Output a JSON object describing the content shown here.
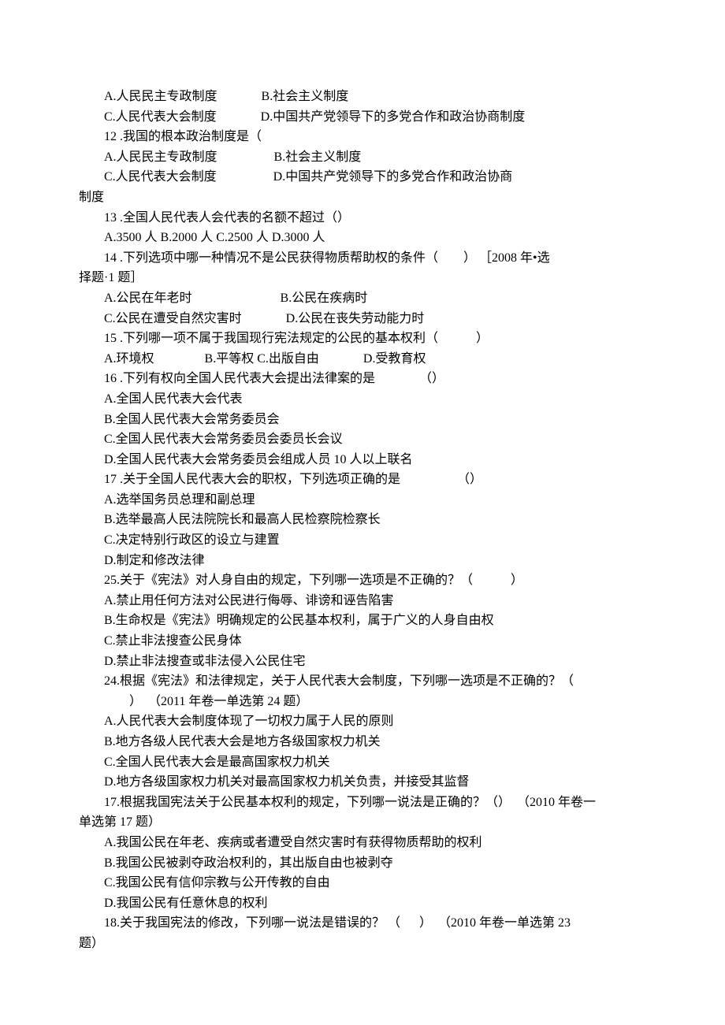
{
  "lines": [
    {
      "cls": "indent1",
      "text": "A.人民民主专政制度              B.社会主义制度"
    },
    {
      "cls": "indent1",
      "text": "C.人民代表大会制度              D.中国共产党领导下的多党合作和政治协商制度"
    },
    {
      "cls": "indent1",
      "text": "12 .我国的根本政治制度是（"
    },
    {
      "cls": "indent1",
      "text": "A.人民民主专政制度                  B.社会主义制度"
    },
    {
      "cls": "indent1",
      "text": "C.人民代表大会制度                  D.中国共产党领导下的多党合作和政治协商"
    },
    {
      "cls": "",
      "text": "制度"
    },
    {
      "cls": "indent1",
      "text": "13 .全国人民代表人会代表的名额不超过（）"
    },
    {
      "cls": "indent1",
      "text": "A.3500 人 B.2000 人 C.2500 人 D.3000 人"
    },
    {
      "cls": "indent1",
      "text": "14 .下列选项中哪一种情况不是公民获得物质帮助权的条件（        ） ［2008 年•选"
    },
    {
      "cls": "",
      "text": "择题·1 题］"
    },
    {
      "cls": "indent1",
      "text": "A.公民在年老时                            B.公民在疾病时"
    },
    {
      "cls": "indent1",
      "text": "C.公民在遭受自然灾害时              D.公民在丧失劳动能力时"
    },
    {
      "cls": "indent1",
      "text": "15 .下列哪一项不属于我国现行宪法规定的公民的基本权利（            ）"
    },
    {
      "cls": "indent1",
      "text": "A.环境权                B.平等权 C.出版自由              D.受教育权"
    },
    {
      "cls": "indent1",
      "text": "16 .下列有权向全国人民代表大会提出法律案的是              （）"
    },
    {
      "cls": "indent1",
      "text": "A.全国人民代表大会代表"
    },
    {
      "cls": "indent1",
      "text": "B.全国人民代表大会常务委员会"
    },
    {
      "cls": "indent1",
      "text": "C.全国人民代表大会常务委员会委员长会议"
    },
    {
      "cls": "indent1",
      "text": "D.全国人民代表大会常务委员会组成人员 10 人以上联名"
    },
    {
      "cls": "indent1",
      "text": "17 .关于全国人民代表大会的职权，下列选项正确的是                  （）"
    },
    {
      "cls": "indent1",
      "text": "A.选举国务员总理和副总理"
    },
    {
      "cls": "indent1",
      "text": "B.选举最高人民法院院长和最高人民检察院检察长"
    },
    {
      "cls": "indent1",
      "text": "C.决定特别行政区的设立与建置"
    },
    {
      "cls": "indent1",
      "text": "D.制定和修改法律"
    },
    {
      "cls": "indent1",
      "text": "25.关于《宪法》对人身自由的规定，下列哪一选项是不正确的？（            ）"
    },
    {
      "cls": "indent1",
      "text": "A.禁止用任何方法对公民进行侮辱、诽谤和诬告陷害"
    },
    {
      "cls": "indent1",
      "text": "B.生命权是《宪法》明确规定的公民基本权利，属于广义的人身自由权"
    },
    {
      "cls": "indent1",
      "text": "C.禁止非法搜查公民身体"
    },
    {
      "cls": "indent1",
      "text": "D.禁止非法搜查或非法侵入公民住宅"
    },
    {
      "cls": "indent1",
      "text": "24.根据《宪法》和法律规定，关于人民代表大会制度，下列哪一选项是不正确的？（"
    },
    {
      "cls": "indent2",
      "text": "）  （2011 年卷一单选第 24 题）"
    },
    {
      "cls": "indent1",
      "text": "A.人民代表大会制度体现了一切权力属于人民的原则"
    },
    {
      "cls": "indent1",
      "text": "B.地方各级人民代表大会是地方各级国家权力机关"
    },
    {
      "cls": "indent1",
      "text": "C.全国人民代表大会是最高国家权力机关"
    },
    {
      "cls": "indent1",
      "text": "D.地方各级国家权力机关对最高国家权力机关负责，并接受其监督"
    },
    {
      "cls": "indent1",
      "text": "17.根据我国宪法关于公民基本权利的规定，下列哪一说法是正确的？（）  （2010 年卷一"
    },
    {
      "cls": "",
      "text": "单选第 17 题）"
    },
    {
      "cls": "indent1",
      "text": "A.我国公民在年老、疾病或者遭受自然灾害时有获得物质帮助的权利"
    },
    {
      "cls": "indent1",
      "text": "B.我国公民被剥夺政治权利的，其出版自由也被剥夺"
    },
    {
      "cls": "indent1",
      "text": "C.我国公民有信仰宗教与公开传教的自由"
    },
    {
      "cls": "indent1",
      "text": "D.我国公民有任意休息的权利"
    },
    {
      "cls": "indent1",
      "text": "18.关于我国宪法的修改，下列哪一说法是错误的？ （      ）  （2010 年卷一单选第 23"
    },
    {
      "cls": "",
      "text": "题）"
    }
  ]
}
